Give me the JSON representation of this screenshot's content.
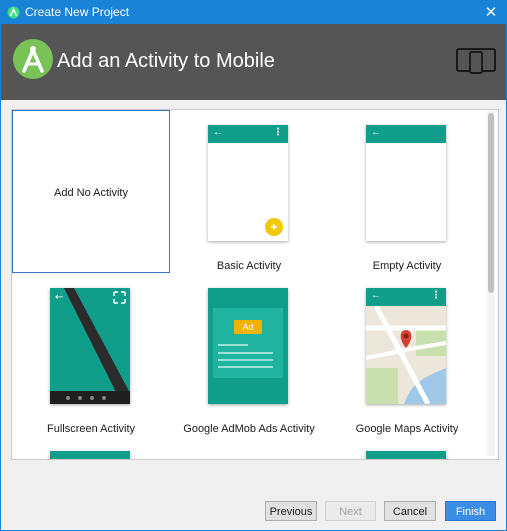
{
  "window": {
    "title": "Create New Project"
  },
  "header": {
    "title": "Add an Activity to Mobile"
  },
  "tiles": [
    {
      "label": "Add No Activity"
    },
    {
      "label": "Basic Activity"
    },
    {
      "label": "Empty Activity"
    },
    {
      "label": "Fullscreen Activity"
    },
    {
      "label": "Google AdMob Ads Activity"
    },
    {
      "label": "Google Maps Activity"
    }
  ],
  "thumbs": {
    "ad_label": "Ad",
    "fab_symbol": "+",
    "back_symbol": "←",
    "menu_symbol": "⋮"
  },
  "buttons": {
    "previous": "Previous",
    "next": "Next",
    "cancel": "Cancel",
    "finish": "Finish"
  },
  "colors": {
    "titlebar": "#1883d7",
    "header": "#555555",
    "toolbar": "#109d8a",
    "fab": "#f2c800",
    "finish": "#3c8de6"
  }
}
